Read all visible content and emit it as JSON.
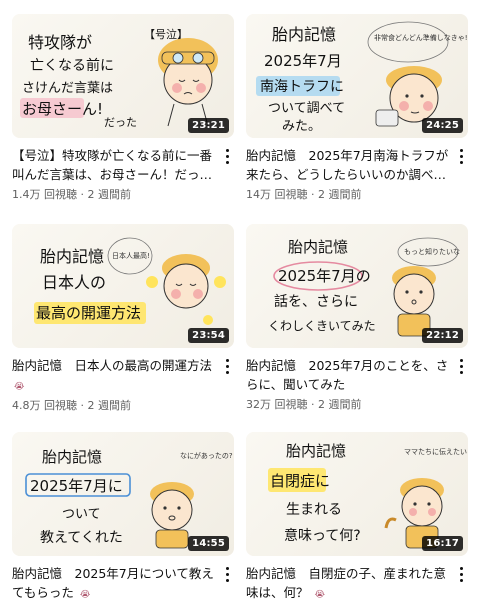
{
  "videos": [
    {
      "thumb_lines": [
        "特攻隊が",
        "亡くなる前に",
        "さけんだ言葉は",
        "お母さーん!",
        "だった"
      ],
      "thumb_tag": "【号泣】",
      "duration": "23:21",
      "title": "【号泣】特攻隊が亡くなる前に一番叫んだ言葉は、お母さーん！だっ…",
      "views": "1.4万 回視聴",
      "age": "2 週間前"
    },
    {
      "thumb_lines": [
        "胎内記憶",
        "2025年7月",
        "南海トラフに",
        "ついて調べて",
        "みた。"
      ],
      "thumb_bubble": "非常食どんどん準備しなきゃ!",
      "duration": "24:25",
      "title": "胎内記憶　2025年7月南海トラフが来たら、どうしたらいいのか調べ…",
      "views": "14万 回視聴",
      "age": "2 週間前"
    },
    {
      "thumb_lines": [
        "胎内記憶",
        "日本人の",
        "最高の開運方法"
      ],
      "thumb_bubble": "日本人最高!",
      "duration": "23:54",
      "title": "胎内記憶　日本人の最高の開運方法",
      "views": "4.8万 回視聴",
      "age": "2 週間前"
    },
    {
      "thumb_lines": [
        "胎内記憶",
        "2025年7月の",
        "話を、さらに",
        "くわしくきいてみた"
      ],
      "thumb_bubble": "もっと知りたいな",
      "duration": "22:12",
      "title": "胎内記憶　2025年7月のことを、さらに、聞いてみた",
      "views": "32万 回視聴",
      "age": "2 週間前"
    },
    {
      "thumb_lines": [
        "胎内記憶",
        "2025年7月に",
        "ついて",
        "教えてくれた"
      ],
      "thumb_bubble": "なにがあったの?",
      "duration": "14:55",
      "title": "胎内記憶　2025年7月について教えてもらった",
      "views": "",
      "age": ""
    },
    {
      "thumb_lines": [
        "胎内記憶",
        "自閉症に",
        "生まれる",
        "意味って何?"
      ],
      "thumb_bubble": "ママたちに伝えたい!",
      "duration": "16:17",
      "title": "胎内記憶　自閉症の子、産まれた意味は、何？",
      "views": "",
      "age": ""
    }
  ],
  "colors": {
    "highlight_pink": "#f6b8c6",
    "highlight_yellow": "#ffe45c",
    "highlight_blue": "#9fd3f2",
    "cheek": "#f3a3a3",
    "hair": "#f2c15a"
  },
  "icons": [
    "more-vert-icon",
    "crying-face-icon"
  ]
}
